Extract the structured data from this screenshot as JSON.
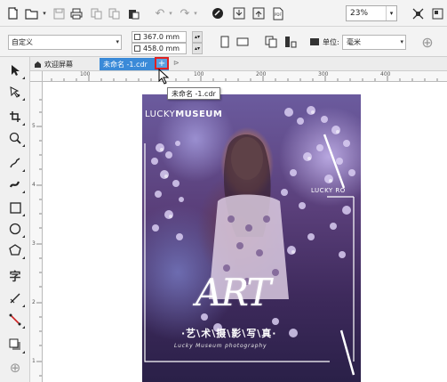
{
  "toolbar": {
    "zoom_value": "23%"
  },
  "property_bar": {
    "paper_preset": "自定义",
    "width_value": "367.0 mm",
    "height_value": "458.0 mm",
    "units_label": "单位:",
    "units_value": "毫米"
  },
  "tabs": {
    "welcome_label": "欢迎屏幕",
    "document_label": "未命名 -1.cdr",
    "add_symbol": "+"
  },
  "tooltip": {
    "text": "未命名 -1.cdr"
  },
  "ruler": {
    "top_numbers": [
      "100",
      "100",
      "200",
      "300",
      "400"
    ],
    "left_numbers": [
      "5",
      "4",
      "3",
      "2",
      "1"
    ]
  },
  "poster": {
    "brand_light": "LUCKY",
    "brand_bold": "MUSEUM",
    "brand_right": "LUCKY RO",
    "art_title": "ART",
    "subtitle": "·艺\\术\\摄\\影\\写\\真·",
    "tagline": "Lucky Museum photography"
  },
  "colors": {
    "active_tab": "#3a8ad8",
    "highlight_border": "#e02020",
    "canvas": "#ffffff",
    "poster_dark": "#2a2048"
  },
  "icons": {
    "new": "new-document-icon",
    "open": "open-folder-icon",
    "save": "save-icon",
    "print": "print-icon",
    "cut": "cut-icon",
    "copy": "copy-icon",
    "paste": "paste-icon",
    "undo": "undo-icon",
    "redo": "redo-icon",
    "search": "search-content-icon",
    "import": "import-icon",
    "export": "export-icon",
    "publish_pdf": "publish-pdf-icon",
    "full_screen": "full-screen-icon",
    "snap": "snap-icon",
    "portrait": "portrait-icon",
    "landscape": "landscape-icon",
    "all_pages": "all-pages-icon",
    "current_page": "current-page-icon",
    "add_page": "add-icon"
  }
}
